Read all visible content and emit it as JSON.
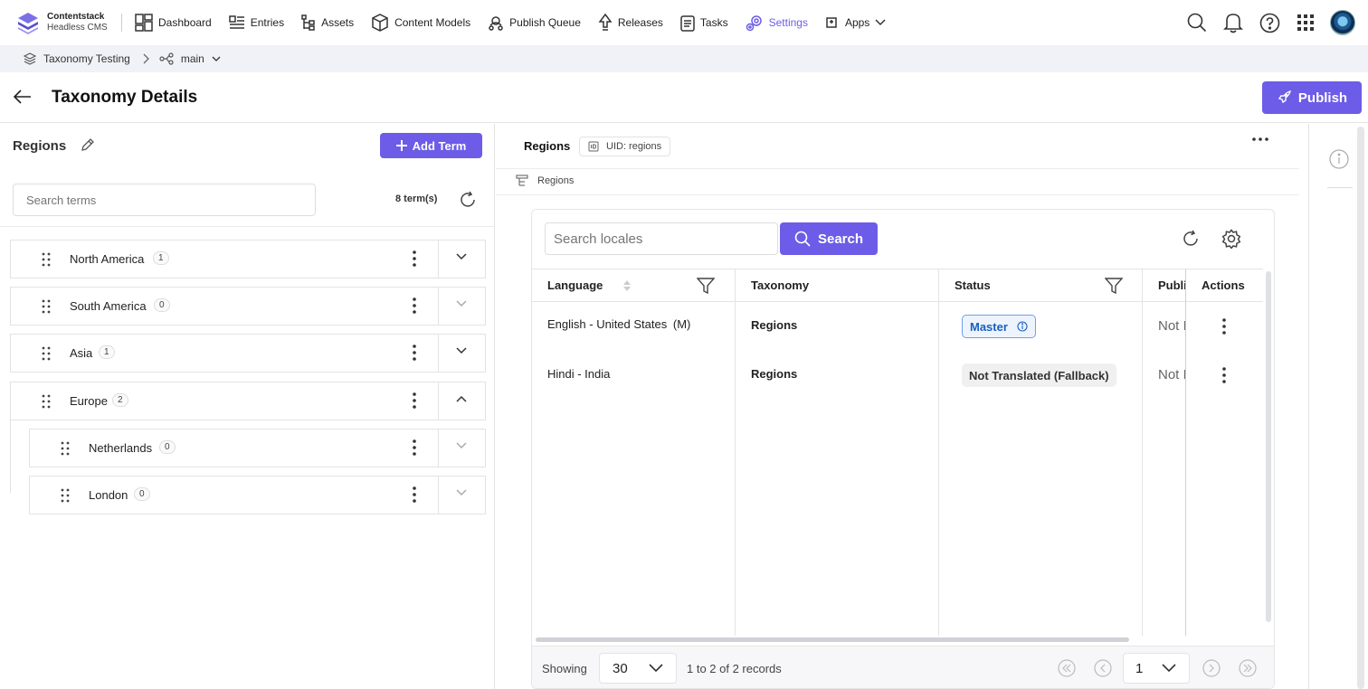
{
  "brand": {
    "name": "Contentstack",
    "subtitle": "Headless CMS"
  },
  "nav": [
    {
      "label": "Dashboard",
      "icon": "dashboard-icon"
    },
    {
      "label": "Entries",
      "icon": "entries-icon"
    },
    {
      "label": "Assets",
      "icon": "assets-icon"
    },
    {
      "label": "Content Models",
      "icon": "content-models-icon"
    },
    {
      "label": "Publish Queue",
      "icon": "publish-queue-icon"
    },
    {
      "label": "Releases",
      "icon": "releases-icon"
    },
    {
      "label": "Tasks",
      "icon": "tasks-icon"
    },
    {
      "label": "Settings",
      "icon": "settings-icon",
      "active": true
    },
    {
      "label": "Apps",
      "icon": "apps-icon"
    }
  ],
  "breadcrumb": {
    "stack": "Taxonomy Testing",
    "branch": "main"
  },
  "header": {
    "title": "Taxonomy Details",
    "publish_label": "Publish"
  },
  "left": {
    "title": "Regions",
    "add_term_label": "Add Term",
    "search_placeholder": "Search terms",
    "term_count": "8 term(s)",
    "terms": [
      {
        "name": "North America",
        "count": "1",
        "expanded": false
      },
      {
        "name": "South America",
        "count": "0",
        "expanded": false
      },
      {
        "name": "Asia",
        "count": "1",
        "expanded": false
      },
      {
        "name": "Europe",
        "count": "2",
        "expanded": true
      },
      {
        "name": "Netherlands",
        "count": "0",
        "child": true
      },
      {
        "name": "London",
        "count": "0",
        "child": true
      }
    ]
  },
  "right": {
    "title": "Regions",
    "uid_label": "UID: regions",
    "sub_title": "Regions",
    "search_placeholder": "Search locales",
    "search_label": "Search",
    "columns": [
      "Language",
      "Taxonomy",
      "Status",
      "Publi",
      "Actions"
    ],
    "rows": [
      {
        "language": "English - United States",
        "language_suffix": "(M)",
        "taxonomy": "Regions",
        "status": "Master",
        "publish": "Not I"
      },
      {
        "language": "Hindi - India",
        "taxonomy": "Regions",
        "status": "Not Translated (Fallback)",
        "publish": "Not I"
      }
    ],
    "footer": {
      "showing": "Showing",
      "page_size": "30",
      "records": "1 to 2 of 2 records",
      "page": "1"
    }
  },
  "colors": {
    "accent": "#6c5ce7",
    "master_blue": "#1a5fbf"
  }
}
